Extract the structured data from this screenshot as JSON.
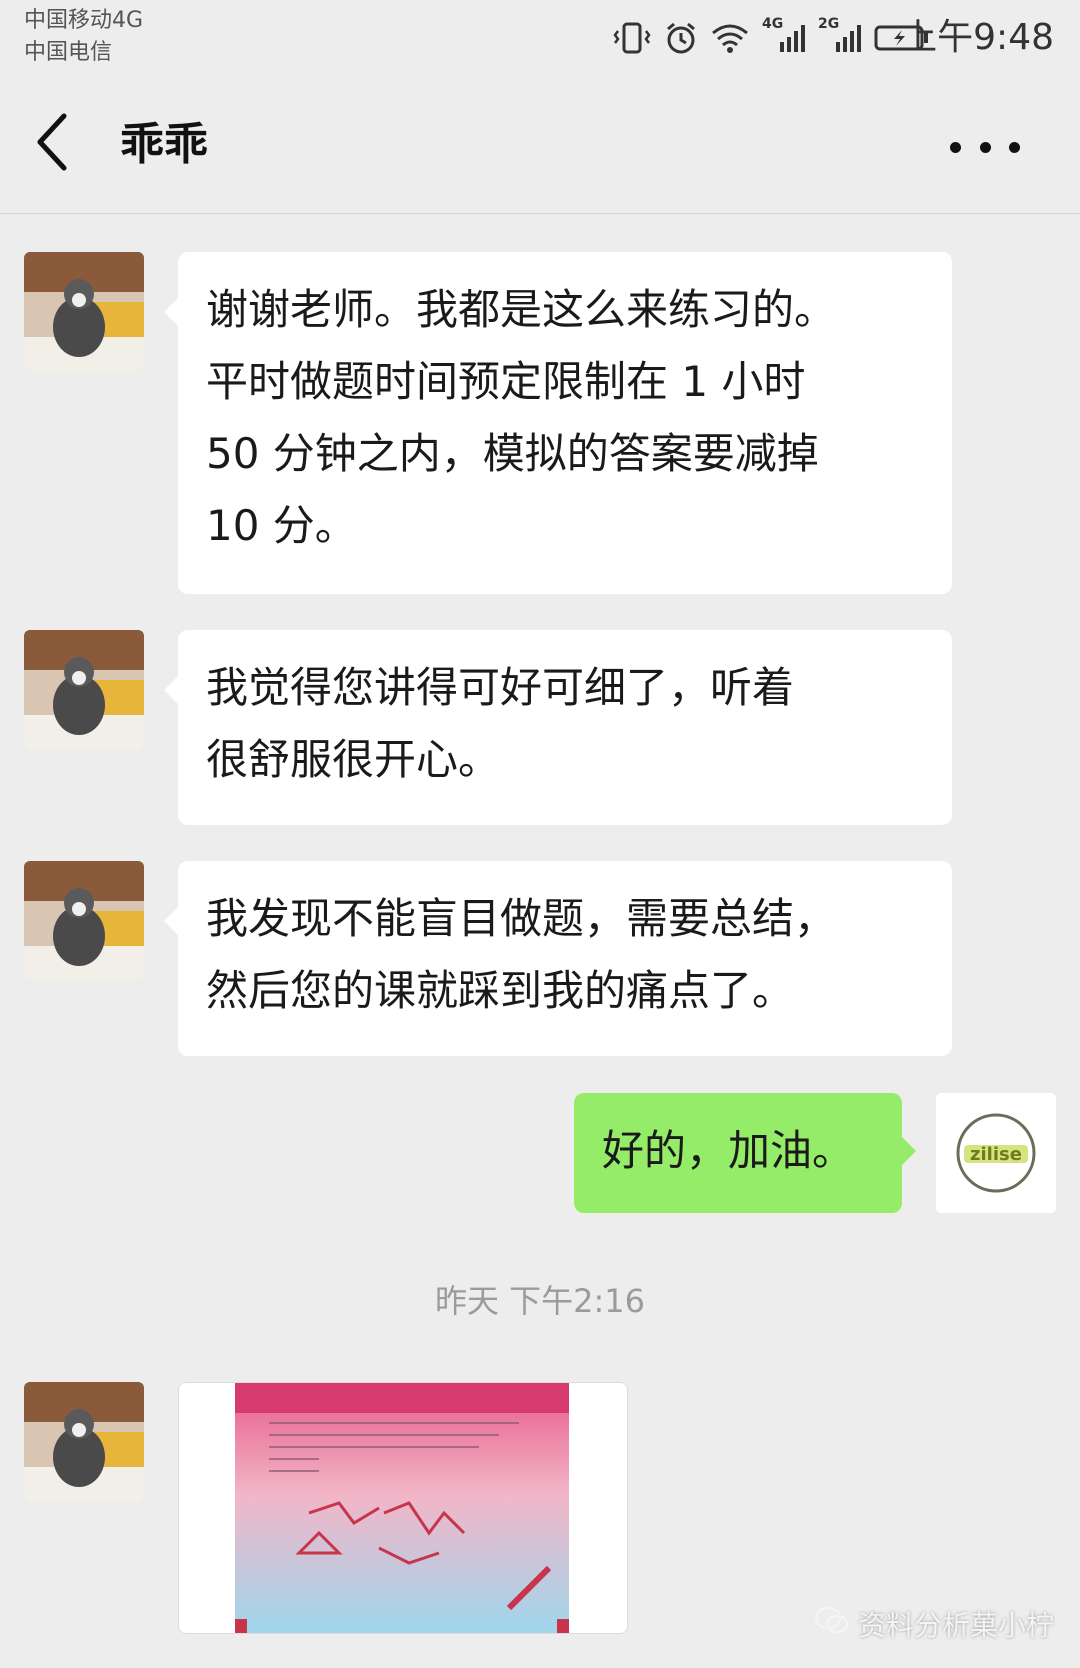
{
  "status_bar": {
    "carrier_1": "中国移动4G",
    "carrier_2": "中国电信",
    "network_1": "4G",
    "network_2": "2G",
    "time": "上午9:48",
    "icons": [
      "vibrate-icon",
      "alarm-icon",
      "wifi-icon",
      "signal-4g-icon",
      "signal-2g-icon",
      "battery-charging-icon"
    ]
  },
  "header": {
    "title": "乖乖",
    "back_icon": "chevron-left-icon",
    "more_icon": "more-dots-icon"
  },
  "messages": [
    {
      "side": "left",
      "lines": [
        "谢谢老师。我都是这么来练习的。",
        "平时做题时间预定限制在 1 小时",
        "50 分钟之内，模拟的答案要减掉",
        "10 分。"
      ]
    },
    {
      "side": "left",
      "lines": [
        "我觉得您讲得可好可细了，听着",
        "很舒服很开心。"
      ]
    },
    {
      "side": "left",
      "lines": [
        "我发现不能盲目做题，需要总结，",
        "然后您的课就踩到我的痛点了。"
      ]
    },
    {
      "side": "right",
      "lines": [
        "好的，加油。"
      ]
    }
  ],
  "own_avatar_logo_text": "zilise",
  "timestamp": "昨天 下午2:16",
  "image_message": {
    "description_icon": "image-thumbnail-icon"
  },
  "watermark": {
    "icon": "wechat-icon",
    "text": "资料分析菓小柠"
  },
  "colors": {
    "background": "#ededed",
    "left_bubble": "#ffffff",
    "right_bubble": "#95ec69",
    "timestamp": "#9b9b9b"
  }
}
